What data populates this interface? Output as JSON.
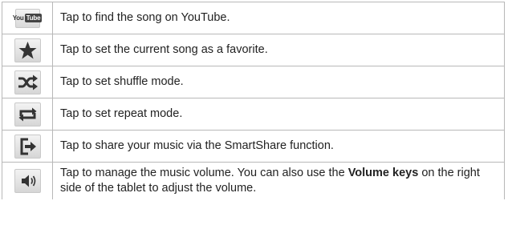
{
  "rows": [
    {
      "icon": "youtube-icon",
      "logo_text": {
        "you": "You",
        "tube": "Tube"
      },
      "text": "Tap to find the song on YouTube."
    },
    {
      "icon": "star-icon",
      "text": "Tap to set the current song as a favorite."
    },
    {
      "icon": "shuffle-icon",
      "text": "Tap to set shuffle mode."
    },
    {
      "icon": "repeat-icon",
      "text": "Tap to set repeat mode."
    },
    {
      "icon": "share-icon",
      "text": "Tap to share your music via the SmartShare function."
    },
    {
      "icon": "volume-icon",
      "text_before": "Tap to manage the music volume. You can also use the ",
      "text_bold": "Volume keys",
      "text_after": " on the right side of the tablet to adjust the volume."
    }
  ],
  "colors": {
    "icon_dark": "#333333",
    "border": "#b8b8b8",
    "text": "#222222"
  }
}
